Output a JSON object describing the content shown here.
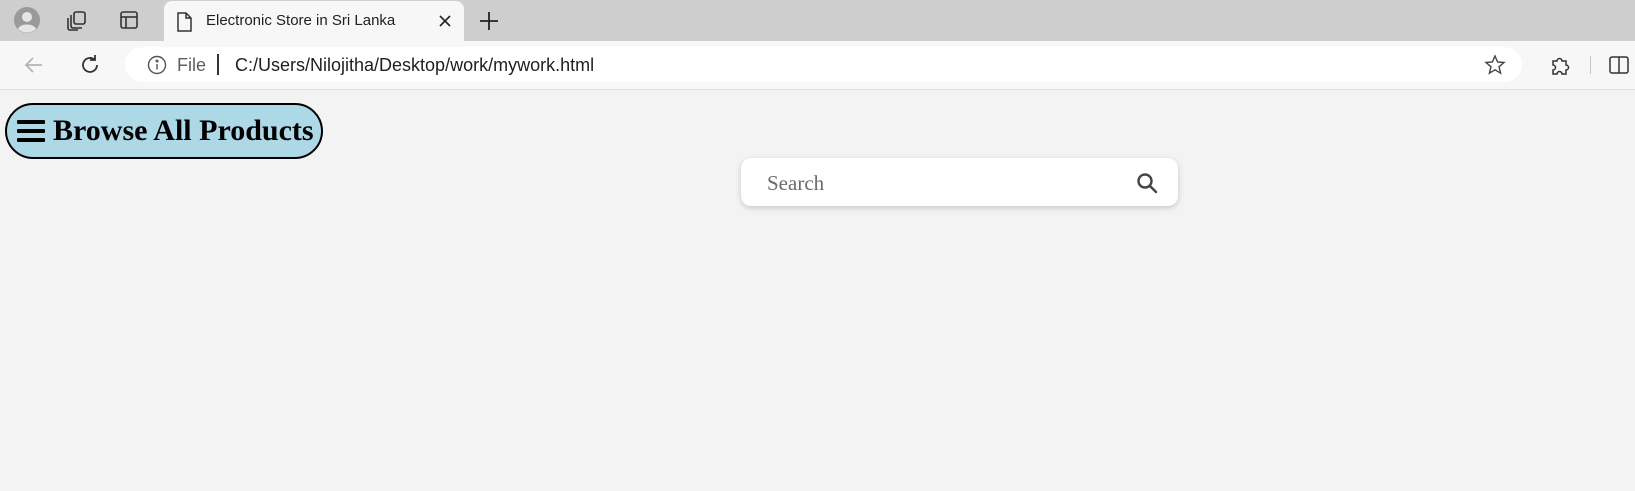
{
  "browser": {
    "tab": {
      "title": "Electronic Store in Sri Lanka"
    },
    "address_bar": {
      "scheme_label": "File",
      "url": "C:/Users/Nilojitha/Desktop/work/mywork.html"
    }
  },
  "page": {
    "browse_button_label": "Browse All Products",
    "search": {
      "placeholder": "Search",
      "value": ""
    }
  },
  "colors": {
    "browse_button_bg": "#add8e6",
    "page_bg": "#f3f3f3",
    "tabbar_bg": "#cecece"
  },
  "icons": {
    "profile": "profile-icon",
    "workspaces": "workspaces-icon",
    "tab_actions": "tab-actions-icon",
    "page": "page-icon",
    "close": "close-icon",
    "new_tab": "plus-icon",
    "back": "back-arrow-icon",
    "refresh": "refresh-icon",
    "info": "info-icon",
    "favorite": "star-icon",
    "extensions": "puzzle-icon",
    "split_screen": "split-screen-icon",
    "menu": "hamburger-icon",
    "search": "search-icon"
  }
}
